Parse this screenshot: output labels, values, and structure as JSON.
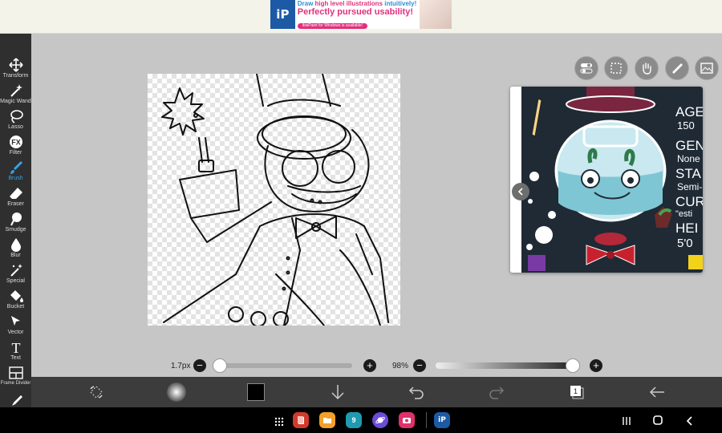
{
  "ad": {
    "logo": "iP",
    "line1_prefix": "Draw ",
    "line1_highlight": "high level illustrations",
    "line1_suffix": " intuitively!",
    "line2": "Perfectly pursued usability!",
    "line3": "ibisPaint for Windows is available!"
  },
  "left_toolbar": {
    "tools": [
      {
        "label": "Transform",
        "icon": "transform-icon"
      },
      {
        "label": "Magic Wand",
        "icon": "magic-wand-icon"
      },
      {
        "label": "Lasso",
        "icon": "lasso-icon"
      },
      {
        "label": "Filter",
        "icon": "fx-icon"
      },
      {
        "label": "Brush",
        "icon": "brush-icon",
        "active": true
      },
      {
        "label": "Eraser",
        "icon": "eraser-icon"
      },
      {
        "label": "Smudge",
        "icon": "smudge-icon"
      },
      {
        "label": "Blur",
        "icon": "blur-icon"
      },
      {
        "label": "Special",
        "icon": "special-icon"
      },
      {
        "label": "Bucket",
        "icon": "bucket-icon"
      },
      {
        "label": "Vector",
        "icon": "vector-icon"
      },
      {
        "label": "Text",
        "icon": "text-icon"
      },
      {
        "label": "Frame Divider",
        "icon": "frame-divider-icon"
      },
      {
        "label": "",
        "icon": "eyedropper-icon"
      }
    ],
    "filter_glyph": "FX",
    "text_glyph": "T"
  },
  "sliders": {
    "brush_size_label": "1.7px",
    "opacity_label": "98%",
    "minus": "−",
    "plus": "+",
    "brush_size_fraction": 0.02,
    "opacity_fraction": 0.98
  },
  "reference": {
    "texts": [
      "AGE",
      "150",
      "GEN",
      "None",
      "STA",
      "Semi-",
      "CUR",
      "\"esti",
      "HEI",
      "5'0"
    ]
  },
  "bottom_toolbar": {
    "layer_count": "1",
    "color": "#000000"
  },
  "nav": {
    "calendar_day": "9",
    "ibis": "iP"
  },
  "colors": {
    "accent": "#3aa0e6",
    "toolbar_bg": "#2f2f2f",
    "ad_pink": "#e2307e"
  }
}
